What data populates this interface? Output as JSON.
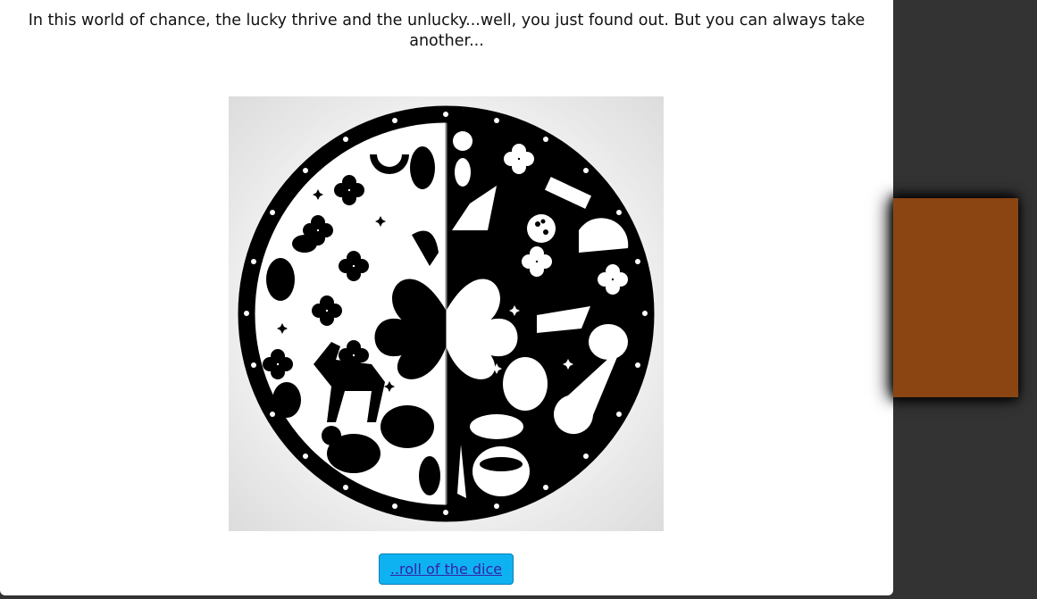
{
  "intro_text": "In this world of chance, the lucky thrive and the unlucky...well, you just found out. But you can always take another...",
  "button": {
    "label": "..roll of the dice"
  },
  "colors": {
    "page_background": "#333333",
    "modal_background": "#ffffff",
    "button_background": "#0fb2f0",
    "button_text": "#3322aa",
    "side_card": "#8b4513"
  },
  "image": {
    "icon": "luck-symbols-circle-image"
  }
}
